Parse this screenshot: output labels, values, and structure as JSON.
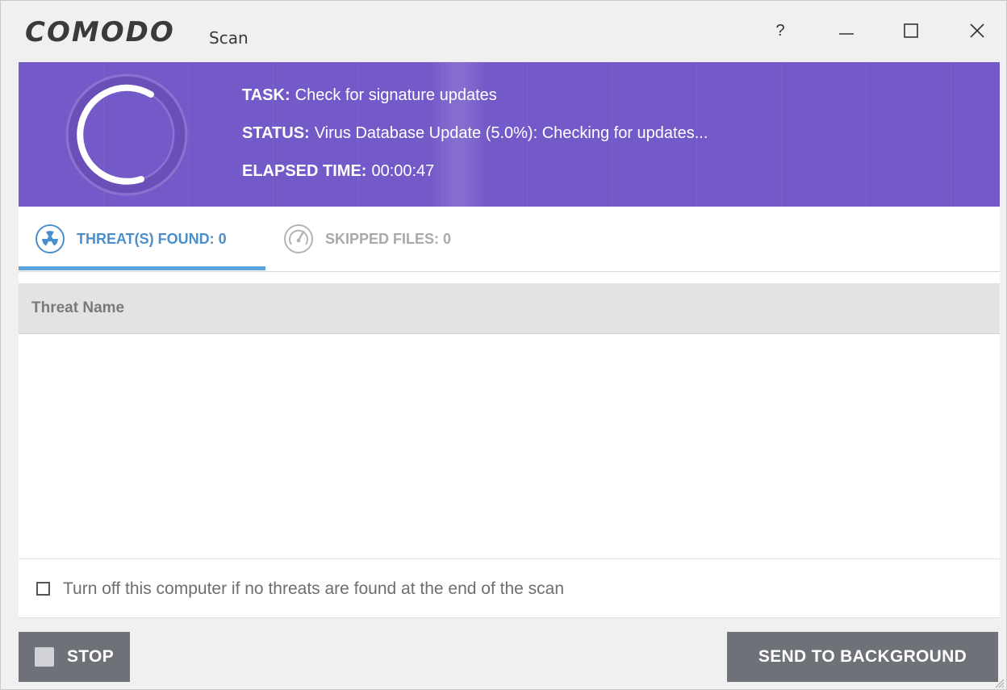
{
  "window": {
    "logo": "COMODO",
    "subtitle": "Scan",
    "help_label": "?"
  },
  "colors": {
    "banner": "#7459c8",
    "accent": "#5ba3dd",
    "button": "#6e7178"
  },
  "banner": {
    "task_key": "TASK:",
    "task_value": "Check for signature updates",
    "status_key": "STATUS:",
    "status_value": "Virus Database Update (5.0%): Checking for updates...",
    "elapsed_key": "ELAPSED TIME:",
    "elapsed_value": "00:00:47",
    "progress_icon": "spinner-ring"
  },
  "tabs": [
    {
      "label": "THREAT(S) FOUND: 0",
      "icon": "radiation-icon",
      "active": true
    },
    {
      "label": "SKIPPED FILES: 0",
      "icon": "skip-dial-icon",
      "active": false
    }
  ],
  "table": {
    "column_header": "Threat Name",
    "rows": []
  },
  "options": {
    "shutdown_label": "Turn off this computer if no threats are found at the end of the scan",
    "shutdown_checked": false
  },
  "buttons": {
    "stop_label": "STOP",
    "background_label": "SEND TO BACKGROUND"
  }
}
